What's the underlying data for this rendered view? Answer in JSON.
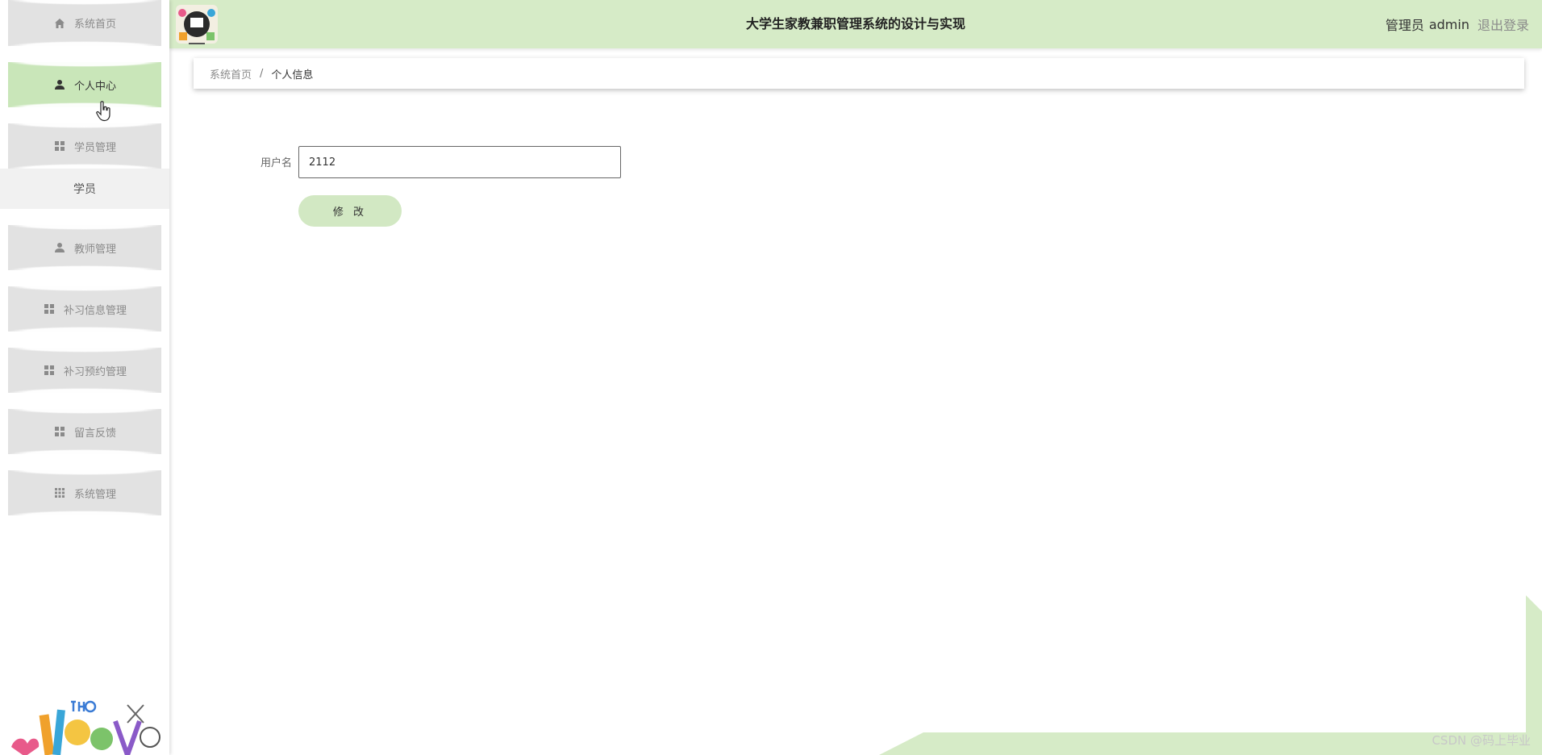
{
  "app": {
    "title": "大学生家教兼职管理系统的设计与实现"
  },
  "header": {
    "user_role": "管理员",
    "user_name": "admin",
    "logout_label": "退出登录"
  },
  "sidebar": {
    "items": [
      {
        "label": "系统首页",
        "icon": "home-icon",
        "active": false
      },
      {
        "label": "个人中心",
        "icon": "user-icon",
        "active": true
      },
      {
        "label": "学员管理",
        "icon": "grid-icon",
        "active": false
      },
      {
        "label": "教师管理",
        "icon": "user-icon",
        "active": false
      },
      {
        "label": "补习信息管理",
        "icon": "grid-icon",
        "active": false
      },
      {
        "label": "补习预约管理",
        "icon": "grid-icon",
        "active": false
      },
      {
        "label": "留言反馈",
        "icon": "grid-icon",
        "active": false
      },
      {
        "label": "系统管理",
        "icon": "apps-icon",
        "active": false
      }
    ],
    "submenu": [
      {
        "label": "学员"
      }
    ]
  },
  "breadcrumb": {
    "home": "系统首页",
    "separator": "/",
    "current": "个人信息"
  },
  "form": {
    "username_label": "用户名",
    "username_value": "2112",
    "submit_label": "修 改"
  },
  "watermark": "CSDN @码上毕业",
  "colors": {
    "accent_green": "#d6ebc7",
    "active_menu": "#c9e6b9",
    "menu_bg": "#e2e2e2",
    "button_bg": "#d2e8c3"
  }
}
